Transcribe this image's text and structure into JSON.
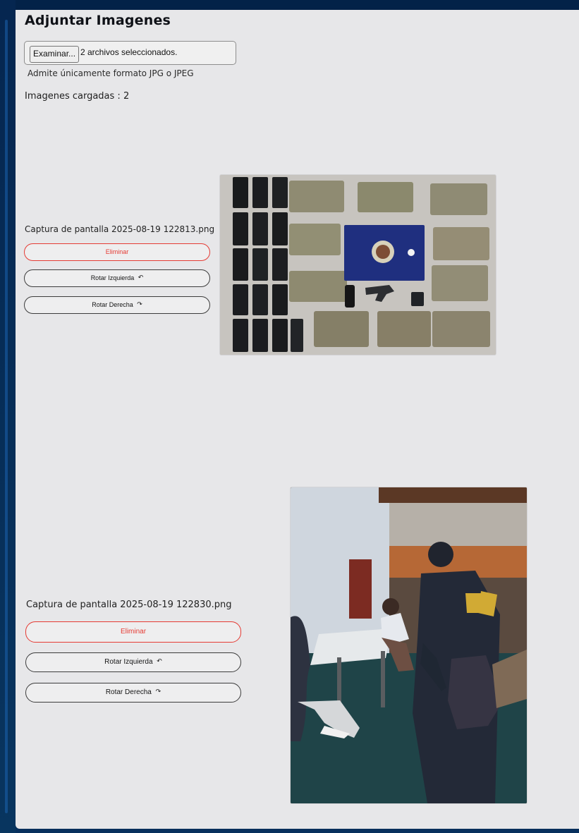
{
  "page": {
    "title": "Adjuntar Imagenes"
  },
  "upload": {
    "button_label": "Examinar...",
    "status": "2 archivos seleccionados.",
    "help_text": "Admite únicamente formato JPG o JPEG",
    "uploaded_count_label": "Imagenes cargadas : 2"
  },
  "images": [
    {
      "filename": "Captura de pantalla 2025-08-19 122813.png",
      "actions": {
        "delete": "Eliminar",
        "rotate_left": "Rotar Izquierda",
        "rotate_right": "Rotar Derecha"
      },
      "icons": {
        "rotate_left": "↶",
        "rotate_right": "↷"
      }
    },
    {
      "filename": "Captura de pantalla 2025-08-19 122830.png",
      "actions": {
        "delete": "Eliminar",
        "rotate_left": "Rotar Izquierda",
        "rotate_right": "Rotar Derecha"
      },
      "icons": {
        "rotate_left": "↶",
        "rotate_right": "↷"
      }
    }
  ],
  "colors": {
    "background": "#06284c",
    "panel": "#e7e7e9",
    "delete_accent": "#e53b34",
    "button_border": "#3c3c3c"
  }
}
